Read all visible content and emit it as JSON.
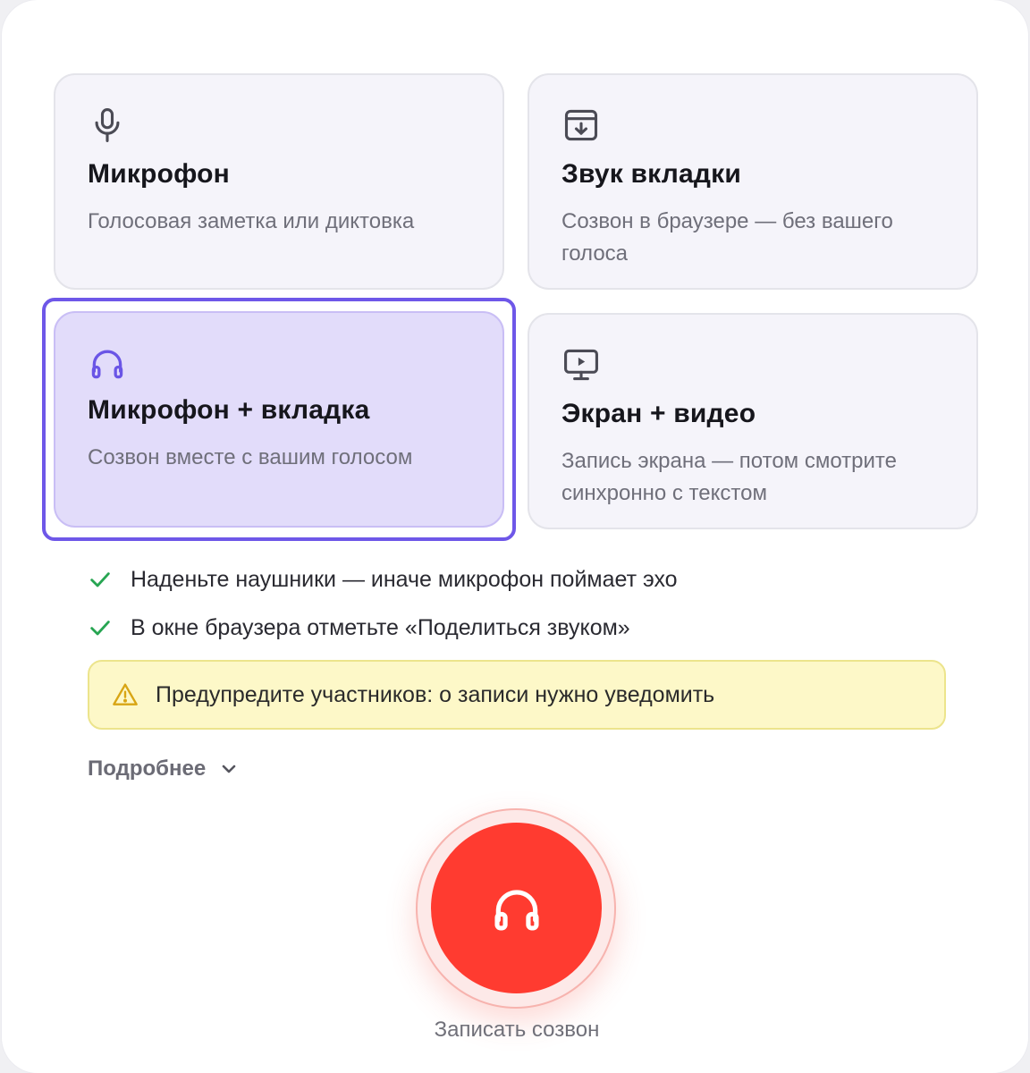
{
  "modes": [
    {
      "icon": "microphone-icon",
      "title": "Микрофон",
      "description": "Голосовая заметка или диктовка",
      "selected": false
    },
    {
      "icon": "tab-audio-icon",
      "title": "Звук вкладки",
      "description": "Созвон в браузере — без вашего голоса",
      "selected": false
    },
    {
      "icon": "headphones-icon",
      "title": "Микрофон + вкладка",
      "description": "Созвон вместе с вашим голосом",
      "selected": true
    },
    {
      "icon": "monitor-play-icon",
      "title": "Экран + видео",
      "description": "Запись экрана — потом смотрите синхронно с текстом",
      "selected": false
    }
  ],
  "checklist": [
    "Наденьте наушники — иначе микрофон поймает эхо",
    "В окне браузера отметьте «Поделиться звуком»"
  ],
  "warning": {
    "icon": "warning-triangle-icon",
    "text": "Предупредите участников: о записи нужно уведомить"
  },
  "details": {
    "label": "Подробнее",
    "icon": "chevron-down-icon"
  },
  "record": {
    "icon": "headphones-icon",
    "label": "Записать созвон"
  },
  "colors": {
    "accent": "#6e57e8",
    "selected_bg": "#e2dcfa",
    "record_red": "#ff3b30",
    "check_green": "#27a552",
    "warning_bg": "#fdf8c8",
    "warning_icon": "#d8a514"
  }
}
